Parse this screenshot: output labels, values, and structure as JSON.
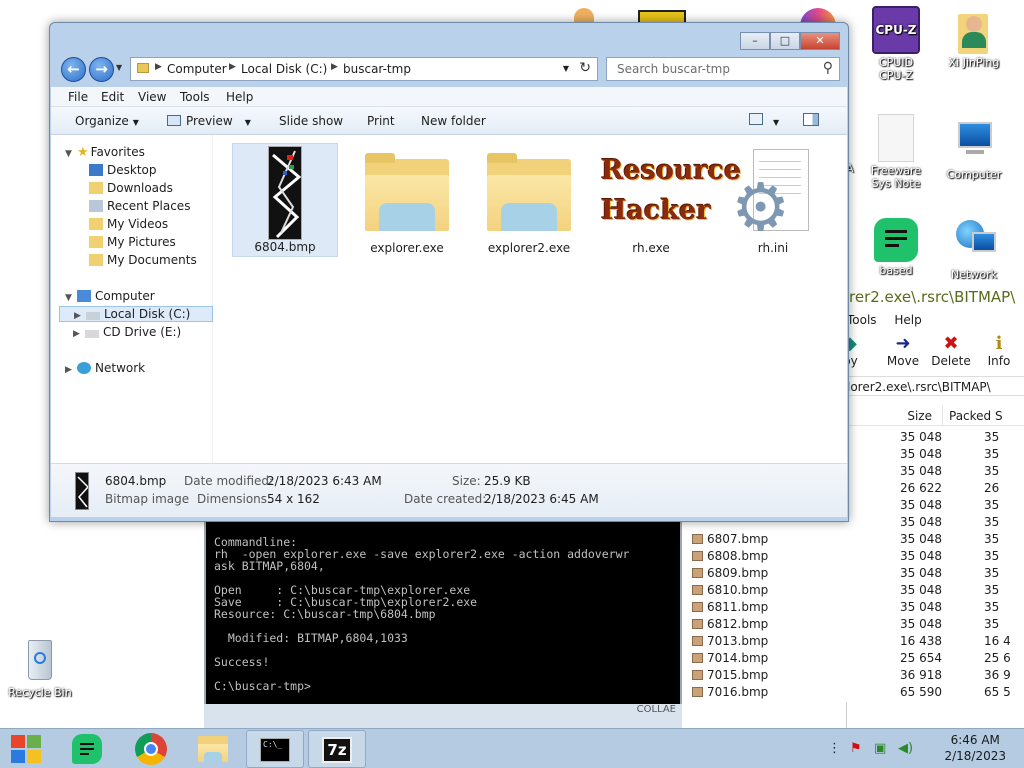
{
  "desktop": {
    "icons": [
      {
        "label": "CPUID\nCPU-Z",
        "name": "cpuz-icon"
      },
      {
        "label": "Xi JinPing",
        "name": "user-folder-icon"
      },
      {
        "label": "Freeware\nSys Note",
        "name": "document-icon"
      },
      {
        "label": "Computer",
        "name": "computer-icon"
      },
      {
        "label": "based",
        "name": "notes-app-icon"
      },
      {
        "label": "Network",
        "name": "network-icon"
      },
      {
        "label": "Recycle Bin",
        "name": "recycle-bin-icon"
      }
    ],
    "partial_letter": "A"
  },
  "explorer": {
    "title_buttons": {
      "minimize": "–",
      "maximize": "□",
      "close": "✕"
    },
    "nav": {
      "back": "←",
      "forward": "→"
    },
    "breadcrumb": [
      "Computer",
      "Local Disk (C:)",
      "buscar-tmp"
    ],
    "search_placeholder": "Search buscar-tmp",
    "menu": [
      "File",
      "Edit",
      "View",
      "Tools",
      "Help"
    ],
    "commands": {
      "organize": "Organize",
      "preview": "Preview",
      "slideshow": "Slide show",
      "print": "Print",
      "new_folder": "New folder"
    },
    "tree": {
      "favorites": "Favorites",
      "favorites_items": [
        "Desktop",
        "Downloads",
        "Recent Places",
        "My Videos",
        "My Pictures",
        "My Documents"
      ],
      "computer": "Computer",
      "computer_items": [
        "Local Disk (C:)",
        "CD Drive (E:)"
      ],
      "network": "Network"
    },
    "files": [
      {
        "name": "6804.bmp",
        "kind": "bmp"
      },
      {
        "name": "explorer.exe",
        "kind": "folder"
      },
      {
        "name": "explorer2.exe",
        "kind": "folder"
      },
      {
        "name": "rh.exe",
        "kind": "rh"
      },
      {
        "name": "rh.ini",
        "kind": "ini"
      }
    ],
    "rh_logo": {
      "line1": "Resource",
      "line2": "Hacker"
    },
    "details": {
      "filename": "6804.bmp",
      "type": "Bitmap image",
      "date_modified_label": "Date modified:",
      "date_modified": "2/18/2023 6:43 AM",
      "dimensions_label": "Dimensions:",
      "dimensions": "54 x 162",
      "size_label": "Size:",
      "size": "25.9 KB",
      "date_created_label": "Date created:",
      "date_created": "2/18/2023 6:45 AM"
    }
  },
  "resource_hacker": {
    "title": "rer2.exe\\.rsrc\\BITMAP\\",
    "menu": [
      "Tools",
      "Help"
    ],
    "tools": [
      {
        "label": "py",
        "icon": "copy-icon",
        "glyph": "◆"
      },
      {
        "label": "Move",
        "icon": "move-arrow-icon",
        "glyph": "➜"
      },
      {
        "label": "Delete",
        "icon": "delete-x-icon",
        "glyph": "✖"
      },
      {
        "label": "Info",
        "icon": "info-icon",
        "glyph": "i"
      }
    ],
    "path": "lorer2.exe\\.rsrc\\BITMAP\\",
    "columns": {
      "size": "Size",
      "packed": "Packed S"
    },
    "rows": [
      {
        "name": "",
        "size": "35 048",
        "packed": "35"
      },
      {
        "name": "",
        "size": "35 048",
        "packed": "35"
      },
      {
        "name": "",
        "size": "35 048",
        "packed": "35"
      },
      {
        "name": "",
        "size": "26 622",
        "packed": "26"
      },
      {
        "name": "",
        "size": "35 048",
        "packed": "35"
      },
      {
        "name": "",
        "size": "35 048",
        "packed": "35"
      },
      {
        "name": "6807.bmp",
        "size": "35 048",
        "packed": "35"
      },
      {
        "name": "6808.bmp",
        "size": "35 048",
        "packed": "35"
      },
      {
        "name": "6809.bmp",
        "size": "35 048",
        "packed": "35"
      },
      {
        "name": "6810.bmp",
        "size": "35 048",
        "packed": "35"
      },
      {
        "name": "6811.bmp",
        "size": "35 048",
        "packed": "35"
      },
      {
        "name": "6812.bmp",
        "size": "35 048",
        "packed": "35"
      },
      {
        "name": "7013.bmp",
        "size": "16 438",
        "packed": "16 4"
      },
      {
        "name": "7014.bmp",
        "size": "25 654",
        "packed": "25 6"
      },
      {
        "name": "7015.bmp",
        "size": "36 918",
        "packed": "36 9"
      },
      {
        "name": "7016.bmp",
        "size": "65 590",
        "packed": "65 5"
      }
    ]
  },
  "console": {
    "lines": [
      "Commandline:",
      "rh  -open explorer.exe -save explorer2.exe -action addoverwr",
      "ask BITMAP,6804,",
      "",
      "Open     : C:\\buscar-tmp\\explorer.exe",
      "Save     : C:\\buscar-tmp\\explorer2.exe",
      "Resource: C:\\buscar-tmp\\6804.bmp",
      "",
      "  Modified: BITMAP,6804,1033",
      "",
      "Success!",
      "",
      "C:\\buscar-tmp>"
    ],
    "watermark": "COLLAE"
  },
  "taskbar": {
    "items": [
      "start-button",
      "notes-app",
      "chrome",
      "file-explorer",
      "console",
      "7zip"
    ],
    "sevenzip_label": "7z",
    "console_label": "C:\\_",
    "time": "6:46 AM",
    "date": "2/18/2023"
  }
}
